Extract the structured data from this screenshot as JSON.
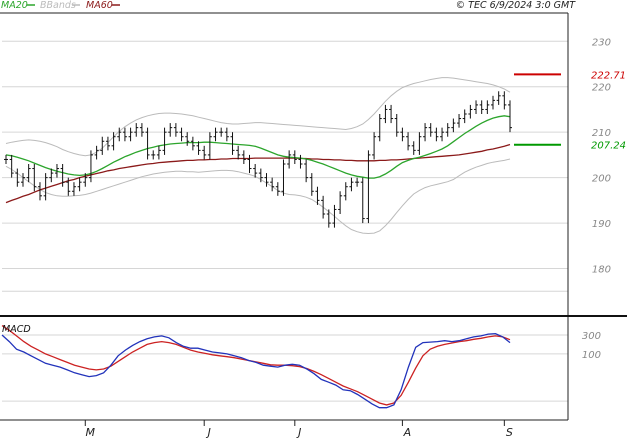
{
  "header": {
    "legend": [
      {
        "label": "MA20",
        "color": "#2ca52c"
      },
      {
        "label": "BBands",
        "color": "#bbbbbb"
      },
      {
        "label": "MA60",
        "color": "#8b1a1a"
      }
    ],
    "source": "© TEC 6/9/2024 3:0 GMT"
  },
  "chart_data": [
    {
      "type": "line",
      "title": "",
      "price_axis": {
        "ticks": [
          "230",
          "220",
          "210",
          "200",
          "190",
          "180"
        ],
        "tick_values": [
          230,
          220,
          210,
          200,
          190,
          180
        ],
        "ylim": [
          170,
          236
        ]
      },
      "x_labels": [
        "M",
        "J",
        "J",
        "A",
        "S"
      ],
      "x_label_index": [
        14,
        35,
        51,
        70,
        88
      ],
      "n_periods": 90,
      "series": [
        {
          "name": "MA20",
          "color": "#2ca52c",
          "values": [
            205,
            204.8,
            204.5,
            204.1,
            203.7,
            203.2,
            202.7,
            202.2,
            201.8,
            201.4,
            201.1,
            200.8,
            200.6,
            200.5,
            200.6,
            200.9,
            201.4,
            202,
            202.7,
            203.4,
            204,
            204.6,
            205.1,
            205.6,
            206,
            206.4,
            206.7,
            207,
            207.2,
            207.4,
            207.5,
            207.6,
            207.7,
            207.7,
            207.7,
            207.8,
            207.8,
            207.7,
            207.6,
            207.5,
            207.4,
            207.3,
            207.2,
            207.1,
            206.9,
            206.5,
            206,
            205.5,
            205,
            204.7,
            204.5,
            204.4,
            204.3,
            204.1,
            203.8,
            203.4,
            203,
            202.5,
            202,
            201.5,
            201,
            200.6,
            200.3,
            200.1,
            199.9,
            199.9,
            200.2,
            200.8,
            201.6,
            202.5,
            203.3,
            203.8,
            204.2,
            204.5,
            204.9,
            205.3,
            205.8,
            206.3,
            207,
            207.9,
            208.8,
            209.7,
            210.5,
            211.3,
            212,
            212.6,
            213.1,
            213.4,
            213.6,
            213.4
          ]
        },
        {
          "name": "MA60",
          "color": "#8b1a1a",
          "values": [
            194.5,
            195,
            195.4,
            195.9,
            196.3,
            196.8,
            197.3,
            197.7,
            198.1,
            198.5,
            198.9,
            199.3,
            199.6,
            200,
            200.3,
            200.6,
            200.9,
            201.2,
            201.5,
            201.7,
            202,
            202.2,
            202.4,
            202.6,
            202.8,
            203,
            203.1,
            203.3,
            203.4,
            203.5,
            203.6,
            203.7,
            203.8,
            203.8,
            203.9,
            203.9,
            204,
            204,
            204.1,
            204.1,
            204.2,
            204.2,
            204.2,
            204.2,
            204.3,
            204.3,
            204.3,
            204.3,
            204.3,
            204.3,
            204.3,
            204.3,
            204.2,
            204.2,
            204.1,
            204.1,
            204,
            204,
            203.9,
            203.9,
            203.8,
            203.8,
            203.7,
            203.7,
            203.7,
            203.7,
            203.8,
            203.8,
            203.9,
            203.9,
            204,
            204.1,
            204.2,
            204.3,
            204.4,
            204.5,
            204.6,
            204.7,
            204.8,
            204.9,
            205,
            205.2,
            205.4,
            205.6,
            205.8,
            206.1,
            206.3,
            206.6,
            206.9,
            207.3
          ]
        },
        {
          "name": "BBands upper",
          "color": "#bbbbbb",
          "values": [
            207.5,
            207.8,
            208,
            208.2,
            208.3,
            208.2,
            208,
            207.7,
            207.3,
            206.8,
            206.2,
            205.7,
            205.3,
            205,
            204.8,
            205,
            205.6,
            206.5,
            207.7,
            209,
            210.2,
            211.2,
            212,
            212.7,
            213.2,
            213.6,
            213.9,
            214.1,
            214.2,
            214.2,
            214.1,
            214,
            213.8,
            213.6,
            213.3,
            213,
            212.7,
            212.4,
            212.1,
            211.9,
            211.8,
            211.8,
            211.9,
            212,
            212.1,
            212.1,
            212,
            211.9,
            211.8,
            211.7,
            211.6,
            211.5,
            211.4,
            211.3,
            211.2,
            211.1,
            211,
            210.9,
            210.8,
            210.7,
            210.6,
            210.8,
            211.2,
            211.8,
            212.8,
            214,
            215.4,
            216.8,
            218,
            219,
            219.8,
            220.3,
            220.7,
            221,
            221.3,
            221.6,
            221.8,
            222,
            222,
            221.9,
            221.7,
            221.5,
            221.3,
            221.1,
            220.9,
            220.7,
            220.4,
            220,
            219.5,
            218.8
          ]
        },
        {
          "name": "BBands lower",
          "color": "#bbbbbb",
          "values": [
            202.5,
            201.8,
            201,
            200,
            199.1,
            198.2,
            197.4,
            196.7,
            196.3,
            196,
            195.9,
            195.9,
            196,
            196.1,
            196.3,
            196.6,
            197,
            197.4,
            197.8,
            198.2,
            198.6,
            199,
            199.4,
            199.8,
            200.2,
            200.5,
            200.8,
            201,
            201.2,
            201.3,
            201.4,
            201.4,
            201.3,
            201.3,
            201.2,
            201.3,
            201.4,
            201.5,
            201.6,
            201.6,
            201.5,
            201.3,
            201,
            200.7,
            200.3,
            199.6,
            198.8,
            198,
            197.2,
            196.6,
            196.3,
            196.2,
            196,
            195.7,
            195.2,
            194.4,
            193.5,
            192.5,
            191.5,
            190.4,
            189.4,
            188.6,
            188.1,
            187.8,
            187.7,
            187.8,
            188.3,
            189.4,
            190.8,
            192.3,
            193.8,
            195.2,
            196.4,
            197.2,
            197.8,
            198.2,
            198.5,
            198.8,
            199.1,
            199.6,
            200.4,
            201.2,
            201.8,
            202.3,
            202.7,
            203.1,
            203.4,
            203.6,
            203.8,
            204.1
          ]
        },
        {
          "name": "Price",
          "color": "#000000",
          "values": [
            204,
            201,
            199,
            200,
            202,
            198,
            196,
            200,
            201,
            202,
            199,
            197,
            198,
            199,
            200,
            205,
            206,
            208,
            207,
            209,
            210,
            209,
            210,
            211,
            210,
            205,
            205,
            206,
            210,
            211,
            210,
            209,
            208,
            207,
            206,
            205,
            209,
            210,
            210,
            209,
            206,
            205,
            204,
            202,
            201,
            200,
            199,
            198,
            197,
            203,
            205,
            204,
            203,
            200,
            197,
            195,
            192,
            190,
            193,
            196,
            198,
            199,
            199,
            191,
            205,
            209,
            213,
            215,
            213,
            210,
            209,
            207,
            206,
            209,
            211,
            210,
            209,
            210,
            211,
            212,
            213,
            214,
            215,
            216,
            215,
            216,
            217,
            218,
            216,
            211
          ]
        }
      ],
      "annotations": [
        {
          "label": "222.71",
          "value": 222.71,
          "color": "#cc0000"
        },
        {
          "label": "207.24",
          "value": 207.24,
          "color": "#009900"
        }
      ]
    },
    {
      "type": "line",
      "title": "MACD",
      "ticks": [
        "300",
        "100"
      ],
      "tick_values": [
        300,
        100
      ],
      "ylim": [
        -600,
        480
      ],
      "series": [
        {
          "name": "MACD",
          "color": "#2233bb",
          "values": [
            300,
            230,
            150,
            120,
            80,
            40,
            0,
            -20,
            -40,
            -70,
            -100,
            -120,
            -140,
            -130,
            -100,
            -20,
            80,
            140,
            190,
            230,
            260,
            280,
            290,
            270,
            220,
            180,
            160,
            160,
            140,
            120,
            110,
            100,
            80,
            60,
            30,
            10,
            -20,
            -30,
            -40,
            -20,
            -10,
            -20,
            -60,
            -110,
            -170,
            -200,
            -230,
            -280,
            -290,
            -330,
            -380,
            -430,
            -470,
            -470,
            -440,
            -280,
            -40,
            170,
            220,
            225,
            230,
            240,
            230,
            240,
            260,
            280,
            290,
            310,
            315,
            280,
            220
          ]
        },
        {
          "name": "Signal",
          "color": "#cc2222",
          "values": [
            400,
            350,
            290,
            230,
            180,
            140,
            100,
            70,
            40,
            10,
            -20,
            -40,
            -60,
            -70,
            -60,
            -30,
            20,
            70,
            120,
            160,
            200,
            220,
            230,
            220,
            200,
            170,
            140,
            120,
            105,
            90,
            80,
            70,
            60,
            45,
            30,
            15,
            0,
            -15,
            -20,
            -20,
            -25,
            -35,
            -55,
            -85,
            -120,
            -160,
            -200,
            -240,
            -270,
            -300,
            -340,
            -380,
            -420,
            -440,
            -420,
            -340,
            -200,
            -50,
            80,
            150,
            180,
            200,
            215,
            230,
            240,
            255,
            265,
            280,
            290,
            280,
            250
          ]
        }
      ]
    }
  ]
}
